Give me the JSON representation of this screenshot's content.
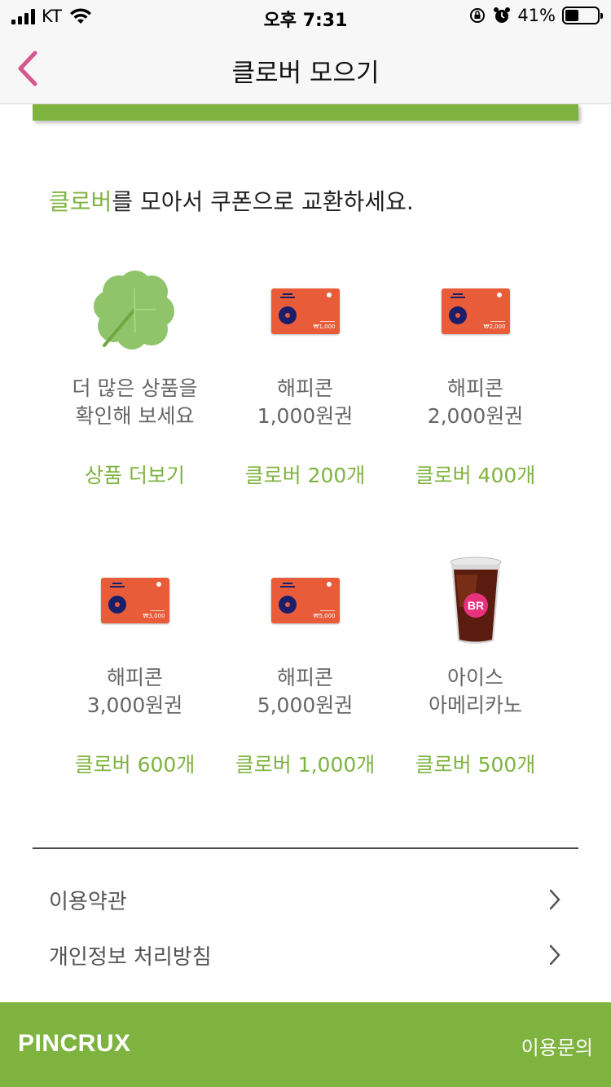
{
  "status_bar": {
    "carrier": "KT",
    "time": "오후 7:31",
    "battery_percent": "41%",
    "battery_level": 0.41
  },
  "nav": {
    "title": "클로버 모으기"
  },
  "headline": {
    "highlight": "클로버",
    "rest": "를 모아서 쿠폰으로 교환하세요."
  },
  "items": [
    {
      "name_line1": "더 많은 상품을",
      "name_line2": "확인해 보세요",
      "price": "상품 더보기",
      "icon": "clover-icon"
    },
    {
      "name_line1": "해피콘",
      "name_line2": "1,000원권",
      "price": "클로버 200개",
      "icon": "happycon-card",
      "card_amount": "₩1,000"
    },
    {
      "name_line1": "해피콘",
      "name_line2": "2,000원권",
      "price": "클로버 400개",
      "icon": "happycon-card",
      "card_amount": "₩2,000"
    },
    {
      "name_line1": "해피콘",
      "name_line2": "3,000원권",
      "price": "클로버 600개",
      "icon": "happycon-card",
      "card_amount": "₩3,000"
    },
    {
      "name_line1": "해피콘",
      "name_line2": "5,000원권",
      "price": "클로버 1,000개",
      "icon": "happycon-card",
      "card_amount": "₩5,000"
    },
    {
      "name_line1": "아이스",
      "name_line2": "아메리카노",
      "price": "클로버 500개",
      "icon": "iced-americano-cup"
    }
  ],
  "links": [
    {
      "label": "이용약관"
    },
    {
      "label": "개인정보 처리방침"
    }
  ],
  "footer": {
    "brand": "PINCRUX",
    "contact": "이용문의"
  },
  "colors": {
    "accent": "#7fb33f",
    "back_arrow": "#d6568f",
    "card": "#e85c3a"
  }
}
